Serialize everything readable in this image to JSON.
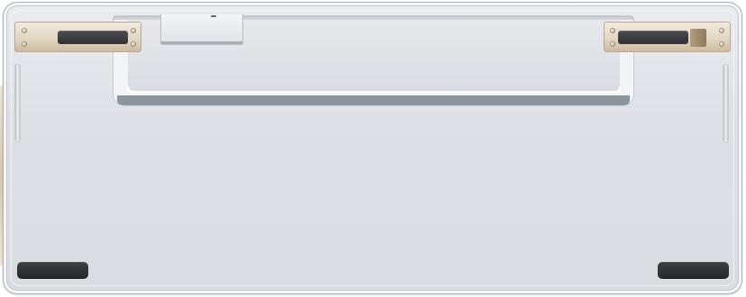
{
  "image": {
    "subject": "keyboard-bottom-view",
    "colors": {
      "case": "#dde0e5",
      "case_edge": "#aab0b8",
      "hinge": "#e3d7c4",
      "hinge_dark": "#8f7a5d",
      "rubber": "#2f3135"
    },
    "parts": {
      "hinges": [
        "left-hinge",
        "right-hinge"
      ],
      "feet": [
        "left-rubber-foot",
        "right-rubber-foot"
      ],
      "slots": [
        "left-side-slot",
        "right-side-slot"
      ]
    }
  }
}
